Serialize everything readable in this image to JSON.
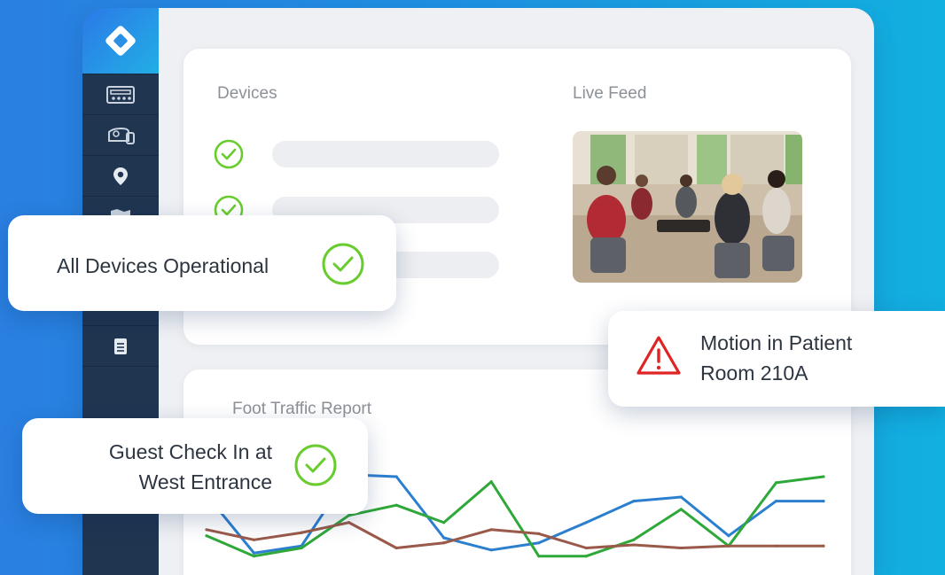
{
  "sidebar": {
    "logo_icon": "diamond-logo-icon",
    "items": [
      {
        "icon": "control-panel-icon"
      },
      {
        "icon": "projector-device-icon"
      },
      {
        "icon": "location-pin-icon"
      },
      {
        "icon": "map-icon"
      },
      {
        "icon": "shield-icon"
      },
      {
        "icon": "document-icon"
      }
    ]
  },
  "devices_card": {
    "devices_label": "Devices",
    "live_feed_label": "Live Feed",
    "device_rows": [
      {
        "status_icon": "check-circle-icon"
      },
      {
        "status_icon": "check-circle-icon"
      },
      {
        "status_icon": "check-circle-icon"
      }
    ]
  },
  "report_card": {
    "title": "Foot Traffic Report"
  },
  "toasts": {
    "devices": {
      "text": "All Devices Operational",
      "icon": "check-circle-icon"
    },
    "motion": {
      "line1": "Motion in Patient",
      "line2": "Room 210A",
      "icon": "warning-triangle-icon"
    },
    "guest": {
      "line1": "Guest Check In at",
      "line2": "West Entrance",
      "icon": "check-circle-icon"
    }
  },
  "colors": {
    "check_green": "#69cc2e",
    "alert_red": "#e02424",
    "series_blue": "#2c7fcf",
    "series_green": "#2fa83a",
    "series_brown": "#9a5a4a"
  },
  "chart_data": {
    "type": "line",
    "title": "Foot Traffic Report",
    "x": [
      1,
      2,
      3,
      4,
      5,
      6,
      7,
      8,
      9,
      10,
      11,
      12,
      13,
      14
    ],
    "series": [
      {
        "values": [
          62,
          5,
          12,
          82,
          80,
          20,
          8,
          15,
          35,
          56,
          60,
          22,
          56,
          56
        ]
      },
      {
        "values": [
          22,
          2,
          10,
          42,
          52,
          35,
          75,
          2,
          2,
          18,
          48,
          12,
          74,
          80
        ]
      },
      {
        "values": [
          28,
          18,
          25,
          35,
          10,
          15,
          28,
          24,
          10,
          13,
          10,
          12,
          12,
          12
        ]
      }
    ],
    "ylim": [
      0,
      100
    ]
  }
}
